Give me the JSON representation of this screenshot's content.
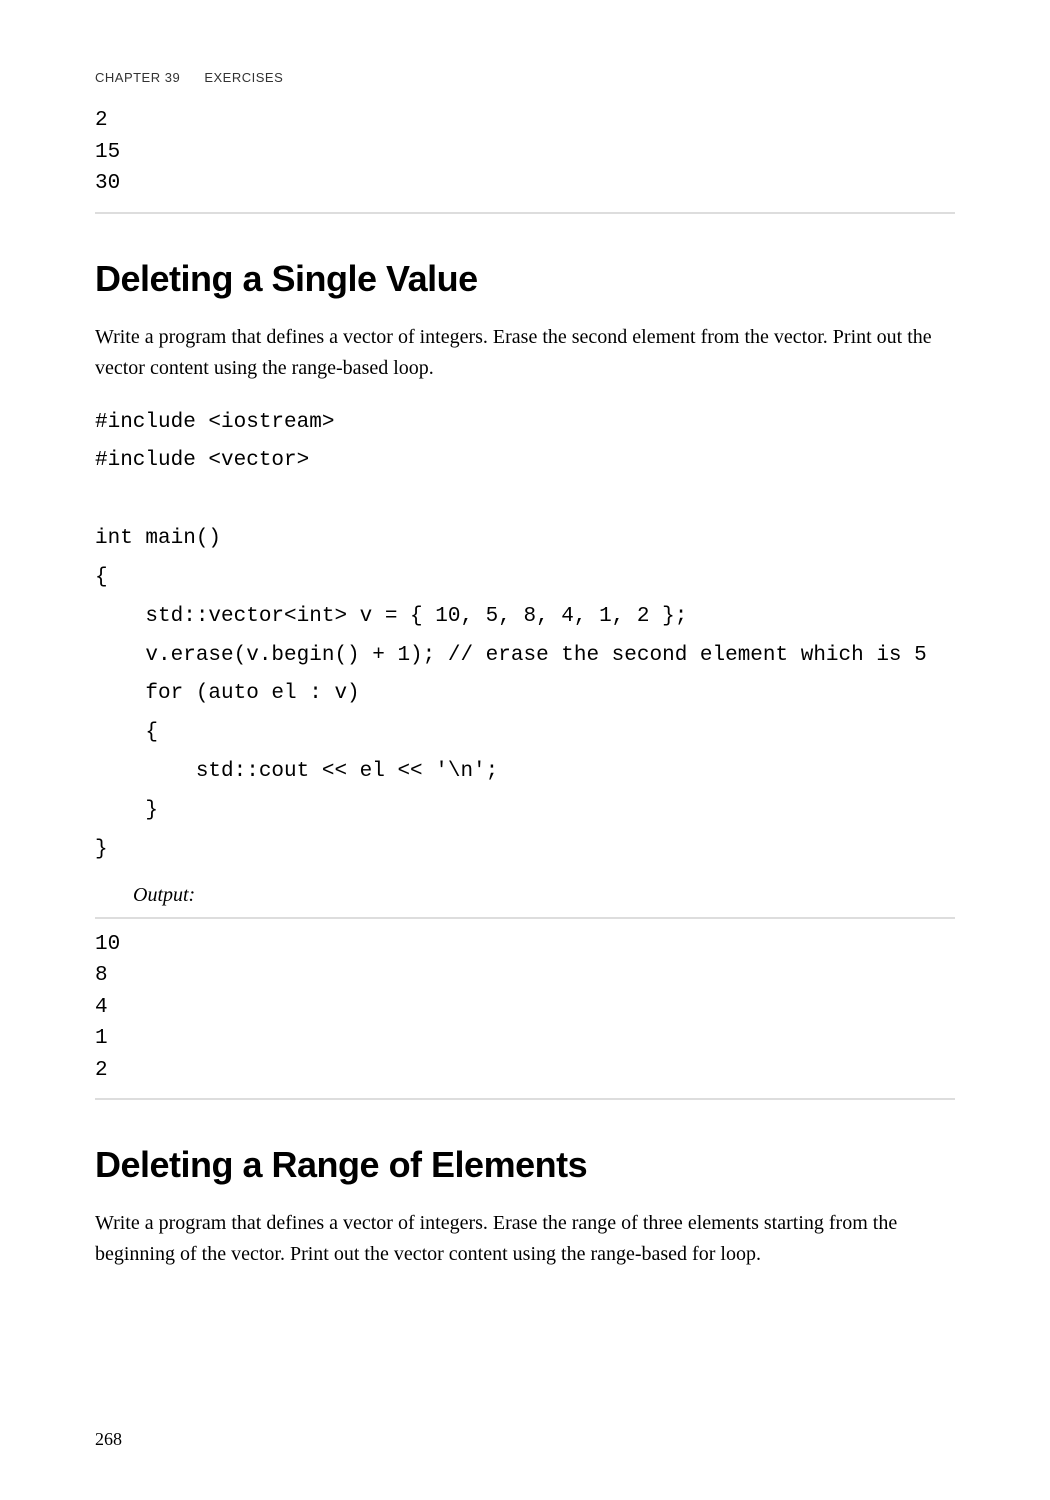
{
  "header": {
    "chapter": "CHAPTER 39",
    "title": "EXERCISES"
  },
  "output1": {
    "lines": [
      "2",
      "15",
      "30"
    ]
  },
  "sections": [
    {
      "heading": "Deleting a Single Value",
      "paragraph": "Write a program that defines a vector of integers. Erase the second element from the vector. Print out the vector content using the range-based loop.",
      "code": "#include <iostream>\n#include <vector>\n\nint main()\n{\n    std::vector<int> v = { 10, 5, 8, 4, 1, 2 };\n    v.erase(v.begin() + 1); // erase the second element which is 5\n    for (auto el : v)\n    {\n        std::cout << el << '\\n';\n    }\n}",
      "output_label": "Output:",
      "output_lines": [
        "10",
        "8",
        "4",
        "1",
        "2"
      ]
    },
    {
      "heading": "Deleting a Range of Elements",
      "paragraph": "Write a program that defines a vector of integers. Erase the range of three elements starting from the beginning of the vector. Print out the vector content using the range-based for loop."
    }
  ],
  "page_number": "268"
}
